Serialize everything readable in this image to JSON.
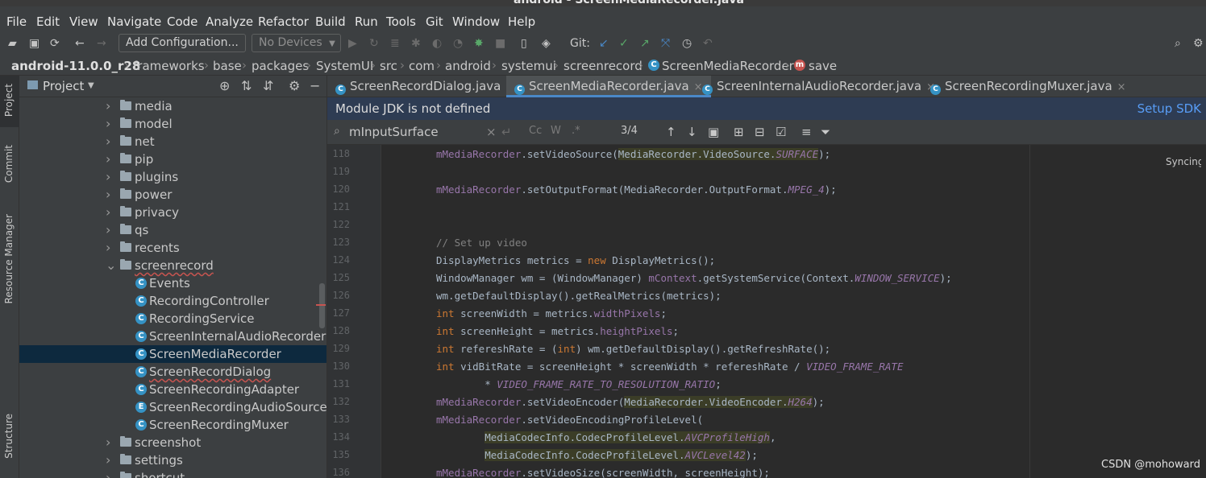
{
  "window": {
    "title": "android - ScreenMediaRecorder.java"
  },
  "menu": [
    "File",
    "Edit",
    "View",
    "Navigate",
    "Code",
    "Analyze",
    "Refactor",
    "Build",
    "Run",
    "Tools",
    "Git",
    "Window",
    "Help"
  ],
  "toolbar": {
    "add_config": "Add Configuration...",
    "devices": "No Devices",
    "git_label": "Git:"
  },
  "breadcrumb": [
    "android-11.0.0_r28",
    "frameworks",
    "base",
    "packages",
    "SystemUI",
    "src",
    "com",
    "android",
    "systemui",
    "screenrecord",
    "ScreenMediaRecorder",
    "save"
  ],
  "side_strip": {
    "project": "Project",
    "commit": "Commit",
    "resource_manager": "Resource Manager",
    "structure": "Structure"
  },
  "project_panel": {
    "title": "Project",
    "tree": [
      {
        "label": "media",
        "type": "folder"
      },
      {
        "label": "model",
        "type": "folder"
      },
      {
        "label": "net",
        "type": "folder"
      },
      {
        "label": "pip",
        "type": "folder"
      },
      {
        "label": "plugins",
        "type": "folder"
      },
      {
        "label": "power",
        "type": "folder"
      },
      {
        "label": "privacy",
        "type": "folder"
      },
      {
        "label": "qs",
        "type": "folder"
      },
      {
        "label": "recents",
        "type": "folder"
      },
      {
        "label": "screenrecord",
        "type": "folder-open"
      },
      {
        "label": "Events",
        "type": "class"
      },
      {
        "label": "RecordingController",
        "type": "class"
      },
      {
        "label": "RecordingService",
        "type": "class"
      },
      {
        "label": "ScreenInternalAudioRecorder",
        "type": "class"
      },
      {
        "label": "ScreenMediaRecorder",
        "type": "class",
        "selected": true
      },
      {
        "label": "ScreenRecordDialog",
        "type": "class"
      },
      {
        "label": "ScreenRecordingAdapter",
        "type": "class"
      },
      {
        "label": "ScreenRecordingAudioSource",
        "type": "enum"
      },
      {
        "label": "ScreenRecordingMuxer",
        "type": "class"
      },
      {
        "label": "screenshot",
        "type": "folder"
      },
      {
        "label": "settings",
        "type": "folder"
      },
      {
        "label": "shortcut",
        "type": "folder"
      }
    ]
  },
  "tabs": [
    {
      "label": "ScreenRecordDialog.java"
    },
    {
      "label": "ScreenMediaRecorder.java",
      "active": true
    },
    {
      "label": "ScreenInternalAudioRecorder.java"
    },
    {
      "label": "ScreenRecordingMuxer.java"
    }
  ],
  "notice": {
    "text": "Module JDK is not defined",
    "action": "Setup SDK"
  },
  "search": {
    "query": "mInputSurface",
    "match_case": "Cc",
    "words": "W",
    "regex": ".*",
    "counter": "3/4"
  },
  "editor": {
    "status": "Syncing...",
    "line_numbers": [
      "118",
      "119",
      "120",
      "121",
      "122",
      "123",
      "124",
      "125",
      "126",
      "127",
      "128",
      "129",
      "130",
      "131",
      "132",
      "133",
      "134",
      "135",
      "136"
    ]
  },
  "watermark": "CSDN @mohoward",
  "colors": {
    "accent": "#4a88c7",
    "editor_bg": "#2b2b2b",
    "panel_bg": "#3c3f41",
    "selection": "#0d293e",
    "notice_bg": "#2e3c53"
  }
}
